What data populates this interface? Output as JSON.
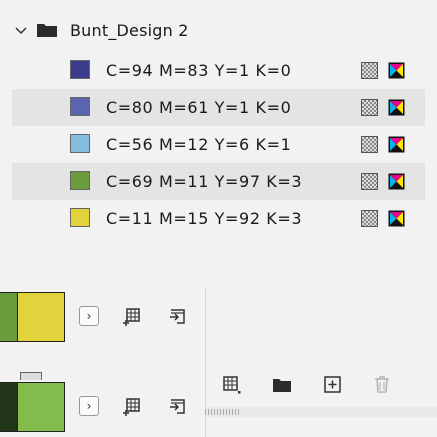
{
  "group": {
    "name": "Bunt_Design 2"
  },
  "swatches": [
    {
      "label": "C=94 M=83 Y=1 K=0",
      "color": "#3b3b8c"
    },
    {
      "label": "C=80 M=61 Y=1 K=0",
      "color": "#5c64ad"
    },
    {
      "label": "C=56 M=12 Y=6 K=1",
      "color": "#86bcde"
    },
    {
      "label": "C=69 M=11 Y=97 K=3",
      "color": "#6b9c3c"
    },
    {
      "label": "C=11 M=15 Y=92 K=3",
      "color": "#e2d23c"
    }
  ],
  "fill_panels": [
    {
      "left_color": "#6b9c3c",
      "right_color": "#e2d23c"
    },
    {
      "left_color": "#22361a",
      "right_color": "#84bd4e"
    }
  ],
  "icons": {
    "expand": "chevron-right-icon",
    "new_swatch_group": "add-to-library-icon",
    "import": "import-icon",
    "swatch_kind": "swatch-kind-menu-icon",
    "new_group": "folder-icon",
    "new_swatch": "new-swatch-icon",
    "delete": "trash-icon"
  },
  "expand_glyph": "›"
}
